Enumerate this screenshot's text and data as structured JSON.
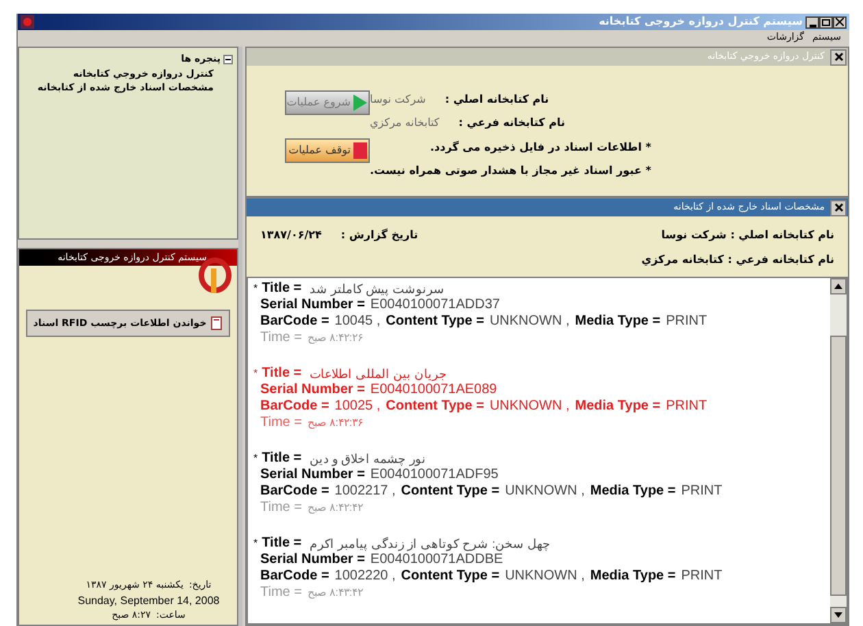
{
  "window": {
    "title": "سیستم کنترل دروازه خروجی کتابخانه"
  },
  "menu": [
    {
      "label": "سیستم"
    },
    {
      "label": "گزارشات"
    }
  ],
  "tree": {
    "label": "پنجره ها",
    "expanded": true,
    "children": [
      {
        "label": "کنترل دروازه خروجي کتابخانه"
      },
      {
        "label": "مشخصات اسناد خارج شده از کتابخانه"
      }
    ]
  },
  "banner": {
    "title": "سیستم کنترل دروازه خروجی کتابخانه"
  },
  "read_button": {
    "label": "خواندن اطلاعات برچسب RFID اسناد"
  },
  "clock": {
    "date_label": "تاریخ:",
    "date_persian": "یکشنبه ۲۴ شهریور ۱۳۸۷",
    "date_english": "Sunday, September 14, 2008",
    "time_label": "ساعت:",
    "time": "۸:۲۷ صبح"
  },
  "gate_panel": {
    "title": "کنترل دروازه خروجي کتابخانه",
    "fields": [
      {
        "label": "نام کتابخانه اصلي :",
        "value": "شرکت نوسا"
      },
      {
        "label": "نام کتابخانه فرعي :",
        "value": "کتابخانه مرکزي"
      }
    ],
    "buttons": [
      {
        "label": "شروع عمليات",
        "kind": "start",
        "disabled": true
      },
      {
        "label": "توقف عمليات",
        "kind": "stop",
        "disabled": false
      }
    ],
    "notes": [
      "* اطلاعات اسناد در فایل ذخیره می گردد.",
      "* عبور اسناد غیر مجاز با هشدار صوتی همراه نیست."
    ]
  },
  "report_panel": {
    "title": "مشخصات اسناد خارج شده از کتابخانه",
    "main_library": "نام کتابخانه اصلي : شرکت نوسا",
    "date_label": "تاريخ گزارش :",
    "date": "۱۳۸۷/۰۶/۲۴",
    "branch_library": "نام کتابخانه فرعي : کتابخانه مرکزي",
    "records": [
      {
        "alert": false,
        "marker": "*",
        "title_label": "Title =",
        "title": "سرنوشت پیش کاملتر شد",
        "serial_label": "Serial Number =",
        "serial": "E0040100071ADD37",
        "barcode_label": "BarCode =",
        "barcode": "10045 ,",
        "content_type_label": "Content Type =",
        "content_type": "UNKNOWN ,",
        "media_type_label": "Media Type =",
        "media_type": "PRINT",
        "time_label": "Time =",
        "time": "۸:۴۲:۲۶ صبح"
      },
      {
        "alert": true,
        "marker": "*",
        "title_label": "Title =",
        "title": "جریان بین المللی اطلاعات",
        "serial_label": "Serial Number =",
        "serial": "E0040100071AE089",
        "barcode_label": "BarCode =",
        "barcode": "10025 ,",
        "content_type_label": "Content Type =",
        "content_type": "UNKNOWN ,",
        "media_type_label": "Media Type =",
        "media_type": "PRINT",
        "time_label": "Time =",
        "time": "۸:۴۲:۳۶ صبح"
      },
      {
        "alert": false,
        "marker": "*",
        "title_label": "Title =",
        "title": "نور چشمه اخلاق و دین",
        "serial_label": "Serial Number =",
        "serial": "E0040100071ADF95",
        "barcode_label": "BarCode =",
        "barcode": "1002217 ,",
        "content_type_label": "Content Type =",
        "content_type": "UNKNOWN ,",
        "media_type_label": "Media Type =",
        "media_type": "PRINT",
        "time_label": "Time =",
        "time": "۸:۴۲:۴۲ صبح"
      },
      {
        "alert": false,
        "marker": "*",
        "title_label": "Title =",
        "title": "چهل سخن: شرح کوتاهی از زندگی پیامبر اکرم",
        "serial_label": "Serial Number =",
        "serial": "E0040100071ADDBE",
        "barcode_label": "BarCode =",
        "barcode": "1002220 ,",
        "content_type_label": "Content Type =",
        "content_type": "UNKNOWN ,",
        "media_type_label": "Media Type =",
        "media_type": "PRINT",
        "time_label": "Time =",
        "time": "۸:۴۳:۴۲ صبح"
      }
    ]
  }
}
